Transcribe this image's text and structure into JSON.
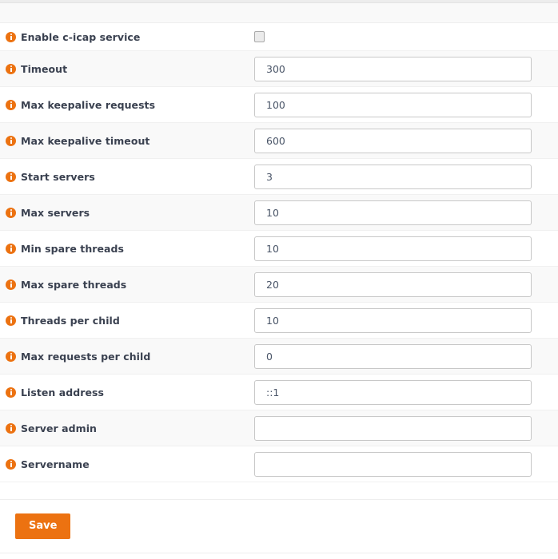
{
  "form": {
    "rows": [
      {
        "label": "Enable c-icap service",
        "type": "checkbox",
        "checked": false,
        "icon": "info-icon",
        "name": "enable-c-icap-service"
      },
      {
        "label": "Timeout",
        "type": "text",
        "value": "300",
        "placeholder": "",
        "icon": "info-icon",
        "name": "timeout"
      },
      {
        "label": "Max keepalive requests",
        "type": "text",
        "value": "100",
        "placeholder": "",
        "icon": "info-icon",
        "name": "max-keepalive-requests"
      },
      {
        "label": "Max keepalive timeout",
        "type": "text",
        "value": "600",
        "placeholder": "",
        "icon": "info-icon",
        "name": "max-keepalive-timeout"
      },
      {
        "label": "Start servers",
        "type": "text",
        "value": "3",
        "placeholder": "",
        "icon": "info-icon",
        "name": "start-servers"
      },
      {
        "label": "Max servers",
        "type": "text",
        "value": "10",
        "placeholder": "",
        "icon": "info-icon",
        "name": "max-servers"
      },
      {
        "label": "Min spare threads",
        "type": "text",
        "value": "10",
        "placeholder": "",
        "icon": "info-icon",
        "name": "min-spare-threads"
      },
      {
        "label": "Max spare threads",
        "type": "text",
        "value": "20",
        "placeholder": "",
        "icon": "info-icon",
        "name": "max-spare-threads"
      },
      {
        "label": "Threads per child",
        "type": "text",
        "value": "10",
        "placeholder": "",
        "icon": "info-icon",
        "name": "threads-per-child"
      },
      {
        "label": "Max requests per child",
        "type": "text",
        "value": "0",
        "placeholder": "",
        "icon": "info-icon",
        "name": "max-requests-per-child"
      },
      {
        "label": "Listen address",
        "type": "text",
        "value": "::1",
        "placeholder": "",
        "icon": "info-icon",
        "name": "listen-address"
      },
      {
        "label": "Server admin",
        "type": "text",
        "value": "",
        "placeholder": "",
        "icon": "info-icon",
        "name": "server-admin"
      },
      {
        "label": "Servername",
        "type": "text",
        "value": "",
        "placeholder": "",
        "icon": "info-icon",
        "name": "servername"
      }
    ]
  },
  "actions": {
    "save_label": "Save"
  },
  "colors": {
    "accent": "#ec7211",
    "label_text": "#3a4150",
    "row_alt_bg": "#f9f9f9",
    "row_bg": "#ffffff",
    "input_border": "#c8c8c8",
    "divider": "#f0f0f0"
  }
}
